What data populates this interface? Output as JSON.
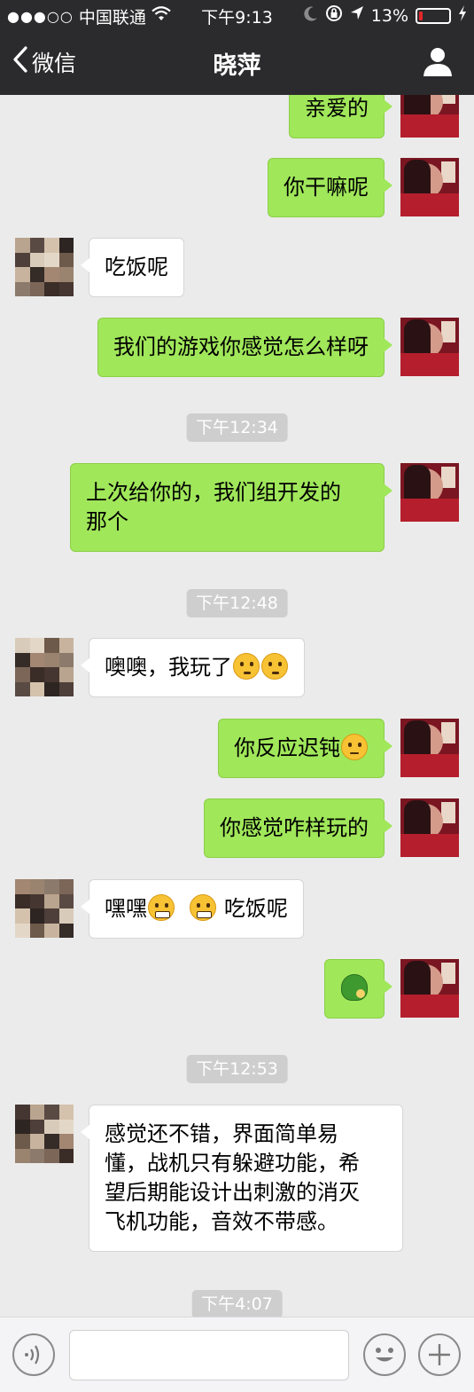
{
  "status_bar": {
    "signal_dots": "●●●○○",
    "carrier": "中国联通",
    "time": "下午9:13",
    "battery_percent": "13%",
    "battery_level": 0.13,
    "wifi_icon": "wifi-icon",
    "moon_icon": "moon-icon",
    "lock_icon": "rotation-lock-icon",
    "location_icon": "location-arrow-icon",
    "charging_icon": "charging-bolt-icon"
  },
  "nav": {
    "back_label": "微信",
    "title": "晓萍",
    "profile_icon": "person-icon"
  },
  "messages": [
    {
      "sender": "me",
      "text": "亲爱的"
    },
    {
      "sender": "me",
      "text": "你干嘛呢"
    },
    {
      "sender": "other",
      "text": "吃饭呢"
    },
    {
      "sender": "me",
      "text": "我们的游戏你感觉怎么样呀"
    },
    {
      "type": "time",
      "text": "下午12:34"
    },
    {
      "sender": "me",
      "line1": "上次给你的，我们组开发的",
      "line2": "那个"
    },
    {
      "type": "time",
      "text": "下午12:48"
    },
    {
      "sender": "other",
      "text": "噢噢，我玩了",
      "emojis": [
        "monocle-face-emoji",
        "monocle-face-emoji"
      ]
    },
    {
      "sender": "me",
      "text": "你反应迟钝",
      "emojis": [
        "thinking-face-emoji"
      ]
    },
    {
      "sender": "me",
      "text": "你感觉咋样玩的"
    },
    {
      "sender": "other",
      "text_a": "嘿嘿",
      "text_b": " 吃饭呢",
      "emojis": [
        "grinning-face-emoji",
        "grinning-face-emoji"
      ]
    },
    {
      "sender": "me",
      "emojis": [
        "tortoise-emoji"
      ]
    },
    {
      "type": "time",
      "text": "下午12:53"
    },
    {
      "sender": "other",
      "lines": [
        "感觉还不错，界面简单易",
        "懂，战机只有躲避功能，希",
        "望后期能设计出刺激的消灭",
        "飞机功能，音效不带感。"
      ]
    },
    {
      "type": "time",
      "text": "下午4:07"
    }
  ],
  "input_bar": {
    "voice_icon": "voice-icon",
    "text_value": "",
    "emoji_icon": "smiley-icon",
    "plus_icon": "plus-icon"
  },
  "colors": {
    "bar_bg": "#2b2b2d",
    "chat_bg": "#ebebeb",
    "my_bubble": "#a0e75a",
    "their_bubble": "#ffffff",
    "timestamp_pill": "#cecece",
    "battery_low": "#e2262c"
  }
}
